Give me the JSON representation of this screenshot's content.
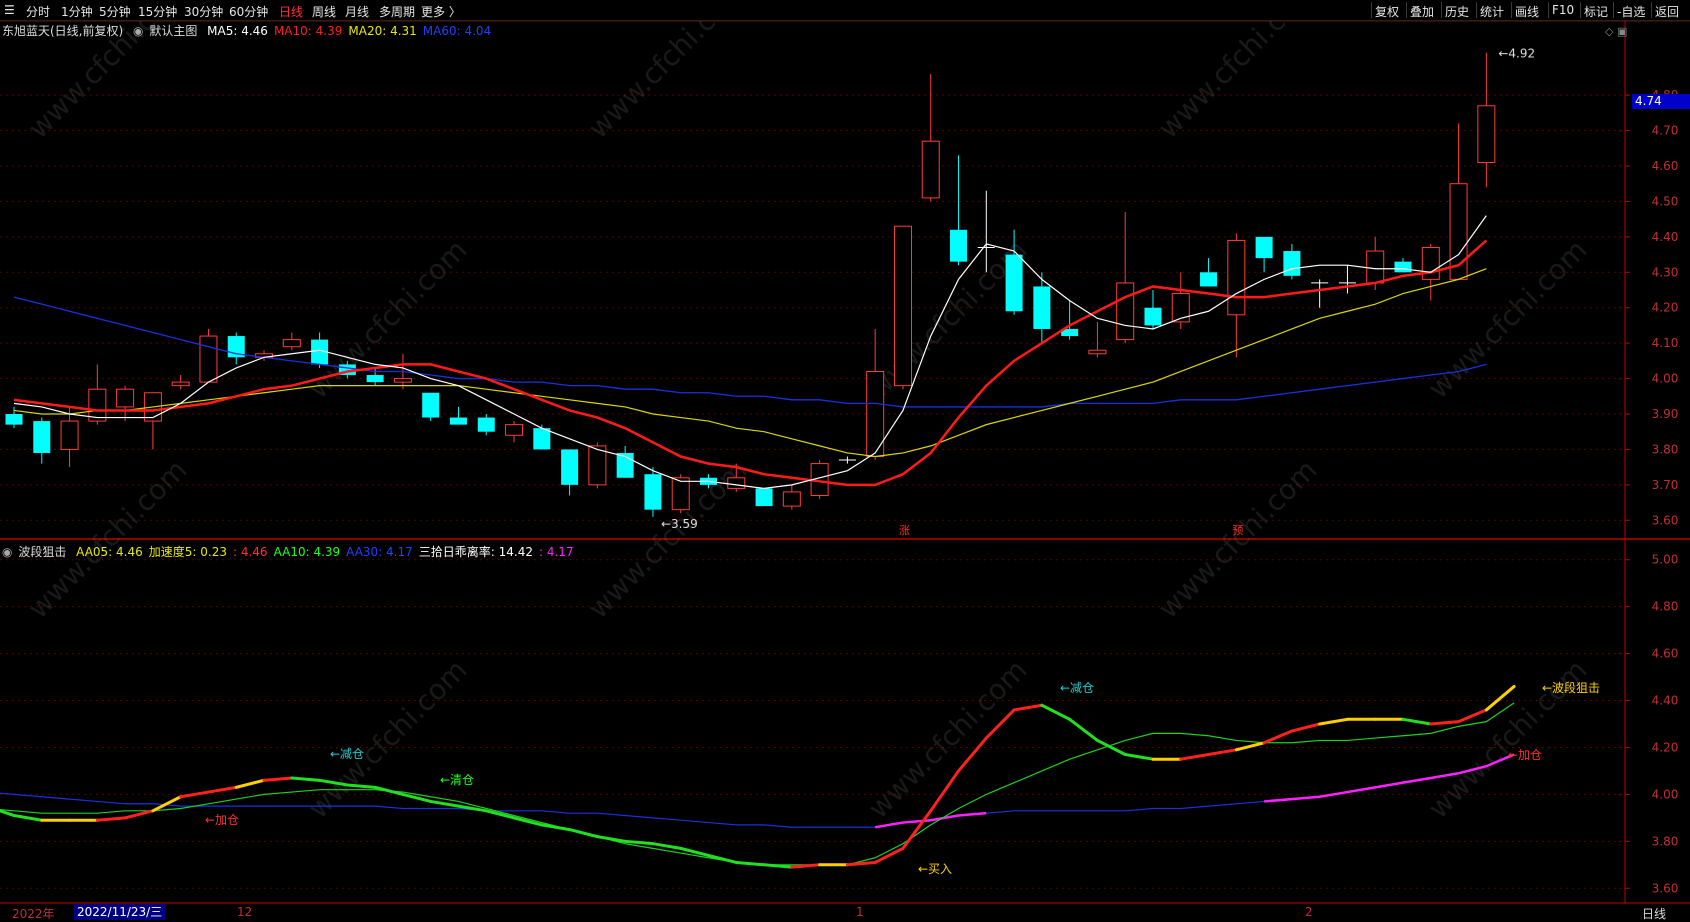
{
  "toolbar": {
    "left_items": [
      "分时",
      "1分钟",
      "5分钟",
      "15分钟",
      "30分钟",
      "60分钟",
      "日线",
      "周线",
      "月线",
      "多周期",
      "更多 〉"
    ],
    "active": "日线",
    "right_items": [
      "复权",
      "叠加",
      "历史",
      "统计",
      "画线",
      "F10",
      "标记",
      "-自选",
      "返回"
    ]
  },
  "main_panel": {
    "title": "东旭蓝天(日线,前复权)",
    "indicator_name": "默认主图",
    "ma": [
      {
        "label": "MA5:",
        "value": "4.46",
        "color": "#ffffff"
      },
      {
        "label": "MA10:",
        "value": "4.39",
        "color": "#ff2020"
      },
      {
        "label": "MA20:",
        "value": "4.31",
        "color": "#e8e800"
      },
      {
        "label": "MA60:",
        "value": "4.04",
        "color": "#2040ff"
      }
    ],
    "y_ticks": [
      "4.80",
      "4.70",
      "4.60",
      "4.50",
      "4.40",
      "4.30",
      "4.20",
      "4.10",
      "4.00",
      "3.90",
      "3.80",
      "3.70",
      "3.60"
    ],
    "current_price": "4.74",
    "high_marker": "4.92",
    "low_marker": "3.59",
    "event_marks": [
      "涨",
      "预"
    ]
  },
  "sub_panel": {
    "name": "波段狙击",
    "items": [
      {
        "label": "AA05:",
        "value": "4.46",
        "color": "#e8e800"
      },
      {
        "label": "加速度5:",
        "value": "0.23",
        "color": "#e8e800"
      },
      {
        "label": ":",
        "value": "4.46",
        "color": "#ff3030"
      },
      {
        "label": "AA10:",
        "value": "4.39",
        "color": "#20ff20"
      },
      {
        "label": "AA30:",
        "value": "4.17",
        "color": "#2040ff"
      },
      {
        "label": "三拾日乖离率:",
        "value": "14.42",
        "color": "#ffffff"
      },
      {
        "label": ":",
        "value": "4.17",
        "color": "#ff20ff"
      }
    ],
    "y_ticks": [
      "5.00",
      "4.80",
      "4.60",
      "4.40",
      "4.20",
      "4.00",
      "3.80",
      "3.60"
    ],
    "annotations": [
      {
        "text": "←减仓",
        "color": "#20d0d0"
      },
      {
        "text": "←清仓",
        "color": "#20ff20"
      },
      {
        "text": "←加仓",
        "color": "#ff3030"
      },
      {
        "text": "←减仓",
        "color": "#20d0d0"
      },
      {
        "text": "←买入",
        "color": "#ffd000"
      },
      {
        "text": "←波段狙击",
        "color": "#ffd000"
      },
      {
        "text": "←加仓",
        "color": "#ff3030"
      }
    ]
  },
  "date_axis": {
    "labels": [
      "2022年",
      "12",
      "1",
      "2"
    ],
    "cursor_date": "2022/11/23/三",
    "period": "日线"
  },
  "watermark": "www.cfchi.com",
  "chart_data": {
    "type": "candlestick",
    "series": [
      {
        "name": "K线",
        "ohlc": [
          [
            3.9,
            3.92,
            3.86,
            3.87
          ],
          [
            3.88,
            3.89,
            3.76,
            3.79
          ],
          [
            3.8,
            3.92,
            3.75,
            3.88
          ],
          [
            3.88,
            4.04,
            3.87,
            3.97
          ],
          [
            3.92,
            3.98,
            3.88,
            3.97
          ],
          [
            3.88,
            3.96,
            3.8,
            3.96
          ],
          [
            3.98,
            4.01,
            3.97,
            3.99
          ],
          [
            3.99,
            4.14,
            3.99,
            4.12
          ],
          [
            4.12,
            4.13,
            4.04,
            4.06
          ],
          [
            4.06,
            4.08,
            4.05,
            4.07
          ],
          [
            4.09,
            4.13,
            4.08,
            4.11
          ],
          [
            4.11,
            4.13,
            4.03,
            4.04
          ],
          [
            4.04,
            4.05,
            4.0,
            4.01
          ],
          [
            4.01,
            4.03,
            3.98,
            3.99
          ],
          [
            3.99,
            4.07,
            3.97,
            4.0
          ],
          [
            3.96,
            3.96,
            3.88,
            3.89
          ],
          [
            3.89,
            3.92,
            3.87,
            3.87
          ],
          [
            3.89,
            3.9,
            3.84,
            3.85
          ],
          [
            3.84,
            3.88,
            3.82,
            3.87
          ],
          [
            3.86,
            3.87,
            3.8,
            3.8
          ],
          [
            3.8,
            3.8,
            3.67,
            3.7
          ],
          [
            3.7,
            3.82,
            3.69,
            3.81
          ],
          [
            3.79,
            3.81,
            3.72,
            3.72
          ],
          [
            3.73,
            3.75,
            3.61,
            3.63
          ],
          [
            3.63,
            3.73,
            3.62,
            3.72
          ],
          [
            3.72,
            3.73,
            3.69,
            3.7
          ],
          [
            3.69,
            3.76,
            3.68,
            3.72
          ],
          [
            3.69,
            3.69,
            3.64,
            3.64
          ],
          [
            3.64,
            3.7,
            3.63,
            3.68
          ],
          [
            3.67,
            3.77,
            3.66,
            3.76
          ],
          [
            3.77,
            3.78,
            3.76,
            3.77
          ],
          [
            3.78,
            4.14,
            3.77,
            4.02
          ],
          [
            3.98,
            4.43,
            3.97,
            4.43
          ],
          [
            4.51,
            4.86,
            4.5,
            4.67
          ],
          [
            4.42,
            4.63,
            4.32,
            4.33
          ],
          [
            4.37,
            4.53,
            4.3,
            4.37
          ],
          [
            4.35,
            4.42,
            4.18,
            4.19
          ],
          [
            4.26,
            4.3,
            4.1,
            4.14
          ],
          [
            4.14,
            4.22,
            4.11,
            4.12
          ],
          [
            4.07,
            4.16,
            4.06,
            4.08
          ],
          [
            4.11,
            4.47,
            4.1,
            4.27
          ],
          [
            4.2,
            4.25,
            4.14,
            4.15
          ],
          [
            4.16,
            4.3,
            4.14,
            4.24
          ],
          [
            4.3,
            4.34,
            4.26,
            4.26
          ],
          [
            4.18,
            4.41,
            4.06,
            4.39
          ],
          [
            4.4,
            4.4,
            4.3,
            4.34
          ],
          [
            4.36,
            4.38,
            4.28,
            4.29
          ],
          [
            4.27,
            4.28,
            4.2,
            4.27
          ],
          [
            4.27,
            4.32,
            4.24,
            4.27
          ],
          [
            4.27,
            4.4,
            4.25,
            4.36
          ],
          [
            4.33,
            4.34,
            4.3,
            4.3
          ],
          [
            4.28,
            4.38,
            4.22,
            4.37
          ],
          [
            4.28,
            4.72,
            4.28,
            4.55
          ],
          [
            4.61,
            4.92,
            4.54,
            4.77
          ]
        ]
      },
      {
        "name": "MA5",
        "values": [
          3.93,
          3.92,
          3.9,
          3.89,
          3.89,
          3.89,
          3.93,
          3.99,
          4.03,
          4.06,
          4.07,
          4.08,
          4.06,
          4.04,
          4.03,
          4.0,
          3.98,
          3.94,
          3.9,
          3.86,
          3.83,
          3.8,
          3.78,
          3.74,
          3.71,
          3.71,
          3.7,
          3.69,
          3.7,
          3.72,
          3.74,
          3.79,
          3.91,
          4.12,
          4.28,
          4.38,
          4.36,
          4.28,
          4.22,
          4.17,
          4.15,
          4.14,
          4.17,
          4.19,
          4.24,
          4.28,
          4.31,
          4.32,
          4.32,
          4.31,
          4.31,
          4.3,
          4.35,
          4.46
        ]
      },
      {
        "name": "MA10",
        "values": [
          3.94,
          3.93,
          3.92,
          3.91,
          3.91,
          3.91,
          3.92,
          3.93,
          3.95,
          3.97,
          3.98,
          4.0,
          4.02,
          4.03,
          4.04,
          4.04,
          4.02,
          4.0,
          3.97,
          3.94,
          3.91,
          3.89,
          3.86,
          3.82,
          3.78,
          3.76,
          3.75,
          3.73,
          3.72,
          3.71,
          3.7,
          3.7,
          3.73,
          3.79,
          3.89,
          3.98,
          4.05,
          4.1,
          4.15,
          4.19,
          4.23,
          4.26,
          4.25,
          4.24,
          4.23,
          4.23,
          4.24,
          4.25,
          4.26,
          4.27,
          4.29,
          4.3,
          4.32,
          4.39
        ]
      },
      {
        "name": "MA20",
        "values": [
          3.91,
          3.9,
          3.9,
          3.91,
          3.91,
          3.92,
          3.93,
          3.94,
          3.95,
          3.96,
          3.97,
          3.98,
          3.98,
          3.98,
          3.98,
          3.98,
          3.98,
          3.97,
          3.96,
          3.95,
          3.94,
          3.93,
          3.92,
          3.9,
          3.89,
          3.88,
          3.86,
          3.85,
          3.83,
          3.81,
          3.79,
          3.78,
          3.79,
          3.81,
          3.84,
          3.87,
          3.89,
          3.91,
          3.93,
          3.95,
          3.97,
          3.99,
          4.02,
          4.05,
          4.08,
          4.11,
          4.14,
          4.17,
          4.19,
          4.21,
          4.24,
          4.26,
          4.28,
          4.31
        ]
      },
      {
        "name": "MA60",
        "values": [
          4.23,
          4.21,
          4.19,
          4.17,
          4.15,
          4.13,
          4.11,
          4.09,
          4.07,
          4.06,
          4.05,
          4.04,
          4.03,
          4.02,
          4.02,
          4.01,
          4.0,
          4.0,
          3.99,
          3.99,
          3.98,
          3.98,
          3.97,
          3.97,
          3.96,
          3.96,
          3.95,
          3.95,
          3.94,
          3.94,
          3.93,
          3.93,
          3.92,
          3.92,
          3.92,
          3.92,
          3.92,
          3.92,
          3.93,
          3.93,
          3.93,
          3.93,
          3.94,
          3.94,
          3.94,
          3.95,
          3.96,
          3.97,
          3.98,
          3.99,
          4.0,
          4.01,
          4.02,
          4.04
        ]
      },
      {
        "name": "AA05",
        "values": [
          3.95,
          3.91,
          3.89,
          3.89,
          3.89,
          3.9,
          3.93,
          3.99,
          4.01,
          4.03,
          4.06,
          4.07,
          4.06,
          4.04,
          4.03,
          4.0,
          3.97,
          3.95,
          3.93,
          3.9,
          3.87,
          3.85,
          3.82,
          3.8,
          3.79,
          3.77,
          3.74,
          3.71,
          3.7,
          3.69,
          3.7,
          3.7,
          3.71,
          3.77,
          3.93,
          4.1,
          4.24,
          4.36,
          4.38,
          4.32,
          4.23,
          4.17,
          4.15,
          4.15,
          4.17,
          4.19,
          4.22,
          4.27,
          4.3,
          4.32,
          4.32,
          4.32,
          4.3,
          4.31,
          4.36,
          4.46
        ]
      },
      {
        "name": "AA10",
        "values": [
          3.94,
          3.93,
          3.92,
          3.92,
          3.92,
          3.93,
          3.93,
          3.94,
          3.96,
          3.98,
          4.0,
          4.01,
          4.02,
          4.02,
          4.02,
          4.01,
          3.99,
          3.97,
          3.94,
          3.91,
          3.88,
          3.85,
          3.82,
          3.79,
          3.77,
          3.75,
          3.73,
          3.71,
          3.7,
          3.7,
          3.7,
          3.7,
          3.73,
          3.79,
          3.87,
          3.94,
          4.0,
          4.05,
          4.1,
          4.15,
          4.19,
          4.23,
          4.26,
          4.26,
          4.25,
          4.23,
          4.22,
          4.22,
          4.23,
          4.23,
          4.24,
          4.25,
          4.26,
          4.29,
          4.31,
          4.39
        ]
      },
      {
        "name": "AA30",
        "values": [
          4.01,
          4.0,
          3.99,
          3.98,
          3.97,
          3.96,
          3.96,
          3.95,
          3.95,
          3.95,
          3.95,
          3.95,
          3.95,
          3.95,
          3.95,
          3.94,
          3.94,
          3.94,
          3.93,
          3.93,
          3.93,
          3.92,
          3.92,
          3.91,
          3.9,
          3.89,
          3.88,
          3.87,
          3.87,
          3.86,
          3.86,
          3.86,
          3.86,
          3.88,
          3.89,
          3.91,
          3.92,
          3.93,
          3.93,
          3.93,
          3.93,
          3.93,
          3.94,
          3.94,
          3.95,
          3.96,
          3.97,
          3.98,
          3.99,
          4.01,
          4.03,
          4.05,
          4.07,
          4.09,
          4.12,
          4.17
        ]
      }
    ],
    "ylim_main": [
      3.55,
      4.95
    ],
    "ylim_sub": [
      3.55,
      5.05
    ]
  }
}
